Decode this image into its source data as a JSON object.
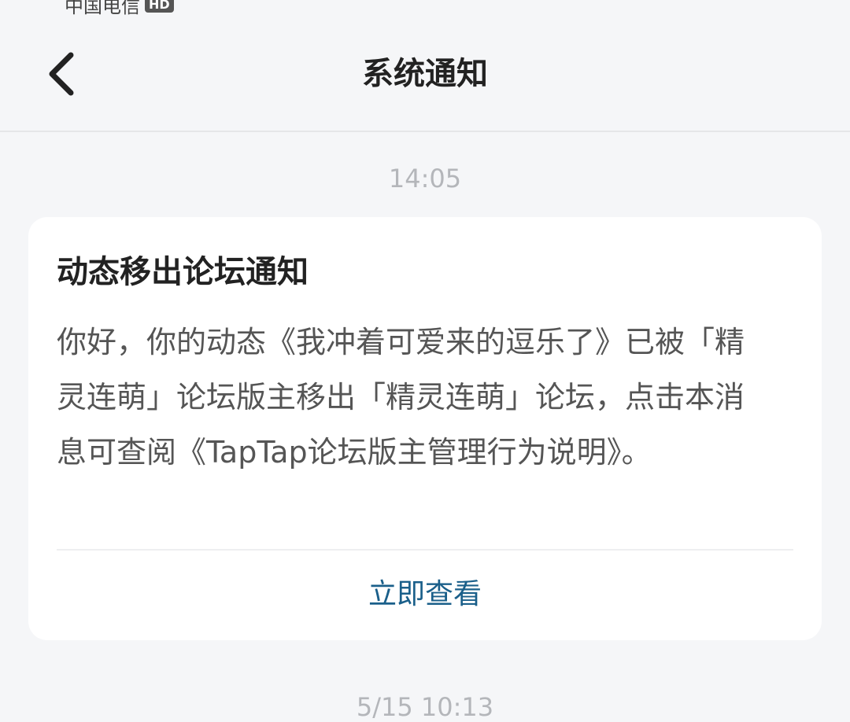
{
  "status_bar": {
    "carrier": "中国电信",
    "network_badge": "HD"
  },
  "nav": {
    "title": "系统通知",
    "back_icon": "chevron-left-icon"
  },
  "messages": [
    {
      "time": "14:05",
      "title": "动态移出论坛通知",
      "body": "你好，你的动态《我冲着可爱来的逗乐了》已被「精灵连萌」论坛版主移出「精灵连萌」论坛，点击本消息可查阅《TapTap论坛版主管理行为说明》。",
      "action_label": "立即查看"
    },
    {
      "time": "5/15  10:13"
    }
  ],
  "colors": {
    "background": "#f5f6f8",
    "card": "#ffffff",
    "title": "#222222",
    "body": "#555555",
    "timestamp": "#b4b6ba",
    "link": "#1a5f8a"
  }
}
